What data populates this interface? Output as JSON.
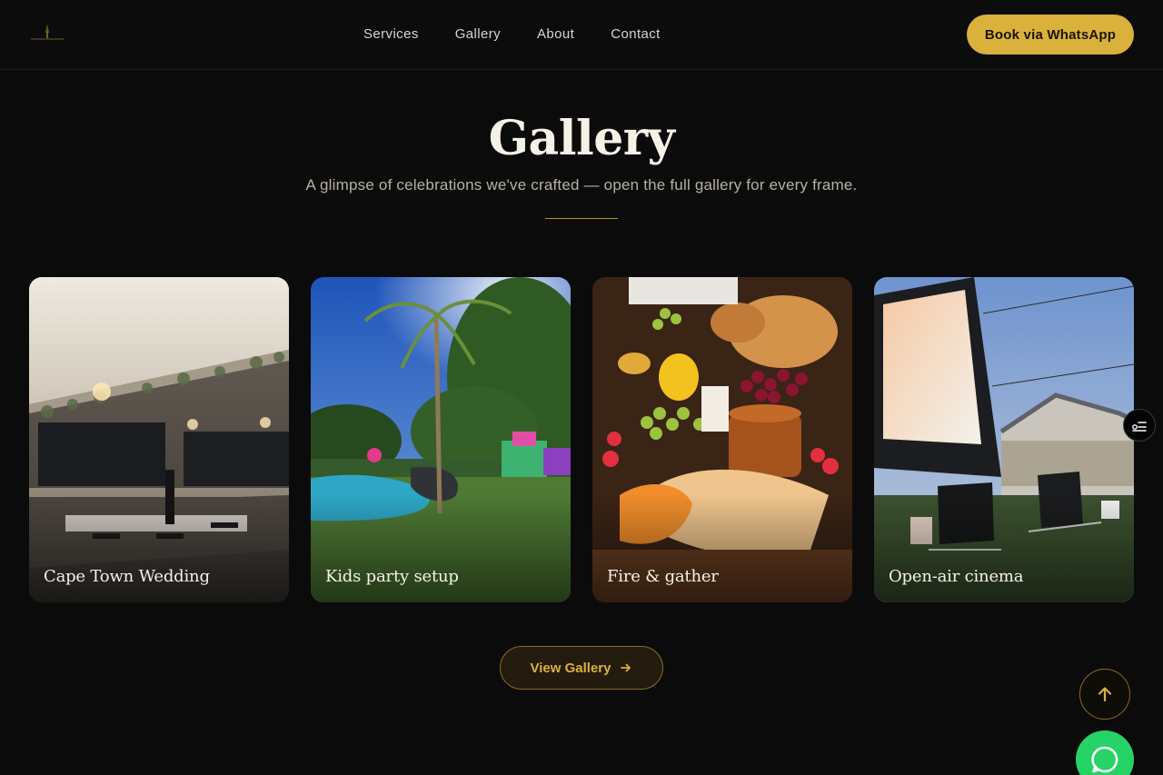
{
  "header": {
    "logo": "brand-logo",
    "nav": [
      {
        "label": "Services"
      },
      {
        "label": "Gallery"
      },
      {
        "label": "About"
      },
      {
        "label": "Contact"
      }
    ],
    "cta_label": "Book via WhatsApp"
  },
  "gallery": {
    "title": "Gallery",
    "subtitle": "A glimpse of celebrations we've crafted — open the full gallery for every frame.",
    "cards": [
      {
        "caption": "Cape Town Wedding"
      },
      {
        "caption": "Kids party setup"
      },
      {
        "caption": "Fire & gather"
      },
      {
        "caption": "Open-air cinema"
      }
    ],
    "view_label": "View Gallery"
  },
  "icons": {
    "view_arrow": "arrow-right-icon",
    "side_tab": "settings-list-icon",
    "back_to_top": "arrow-up-icon",
    "whatsapp": "whatsapp-icon"
  },
  "colors": {
    "accent": "#d9b13b",
    "background": "#0b0b0b",
    "whatsapp": "#25d366"
  }
}
